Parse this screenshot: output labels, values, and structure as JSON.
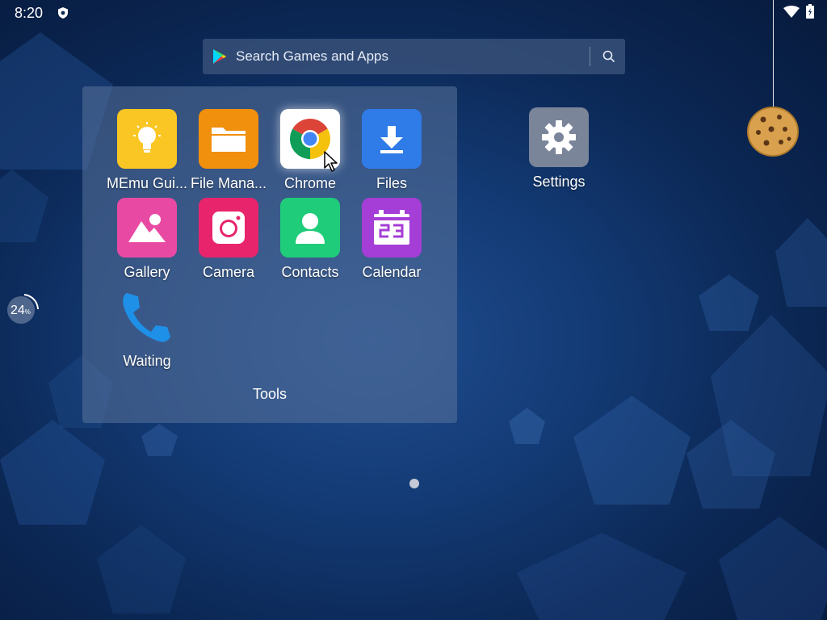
{
  "status_bar": {
    "time": "8:20",
    "left_icons": [
      "shield-icon"
    ],
    "right_icons": [
      "wifi-icon",
      "battery-icon"
    ]
  },
  "search": {
    "placeholder": "Search Games and Apps",
    "icon": "search-icon",
    "brand_icon": "google-play-icon"
  },
  "folder": {
    "name": "Tools",
    "apps": [
      {
        "label": "MEmu Gui...",
        "icon": "lightbulb-icon",
        "color": "#f9c623"
      },
      {
        "label": "File Mana...",
        "icon": "folder-icon",
        "color": "#f0900d"
      },
      {
        "label": "Chrome",
        "icon": "chrome-icon",
        "color": "#ffffff"
      },
      {
        "label": "Files",
        "icon": "download-icon",
        "color": "#2f7be8"
      },
      {
        "label": "Gallery",
        "icon": "image-icon",
        "color": "#e84aa3"
      },
      {
        "label": "Camera",
        "icon": "camera-icon",
        "color": "#e8246c"
      },
      {
        "label": "Contacts",
        "icon": "person-icon",
        "color": "#1fcc7a"
      },
      {
        "label": "Calendar",
        "icon": "calendar-icon",
        "color": "#a43ed6"
      },
      {
        "label": "Waiting",
        "icon": "phone-icon",
        "color": "#1e90e8"
      }
    ]
  },
  "desktop": {
    "settings": {
      "label": "Settings",
      "icon": "gear-icon"
    },
    "ram_widget": {
      "value": "24",
      "unit": "%"
    },
    "cookie": {
      "icon": "cookie-icon"
    }
  },
  "pager": {
    "pages": 1,
    "current": 1
  }
}
